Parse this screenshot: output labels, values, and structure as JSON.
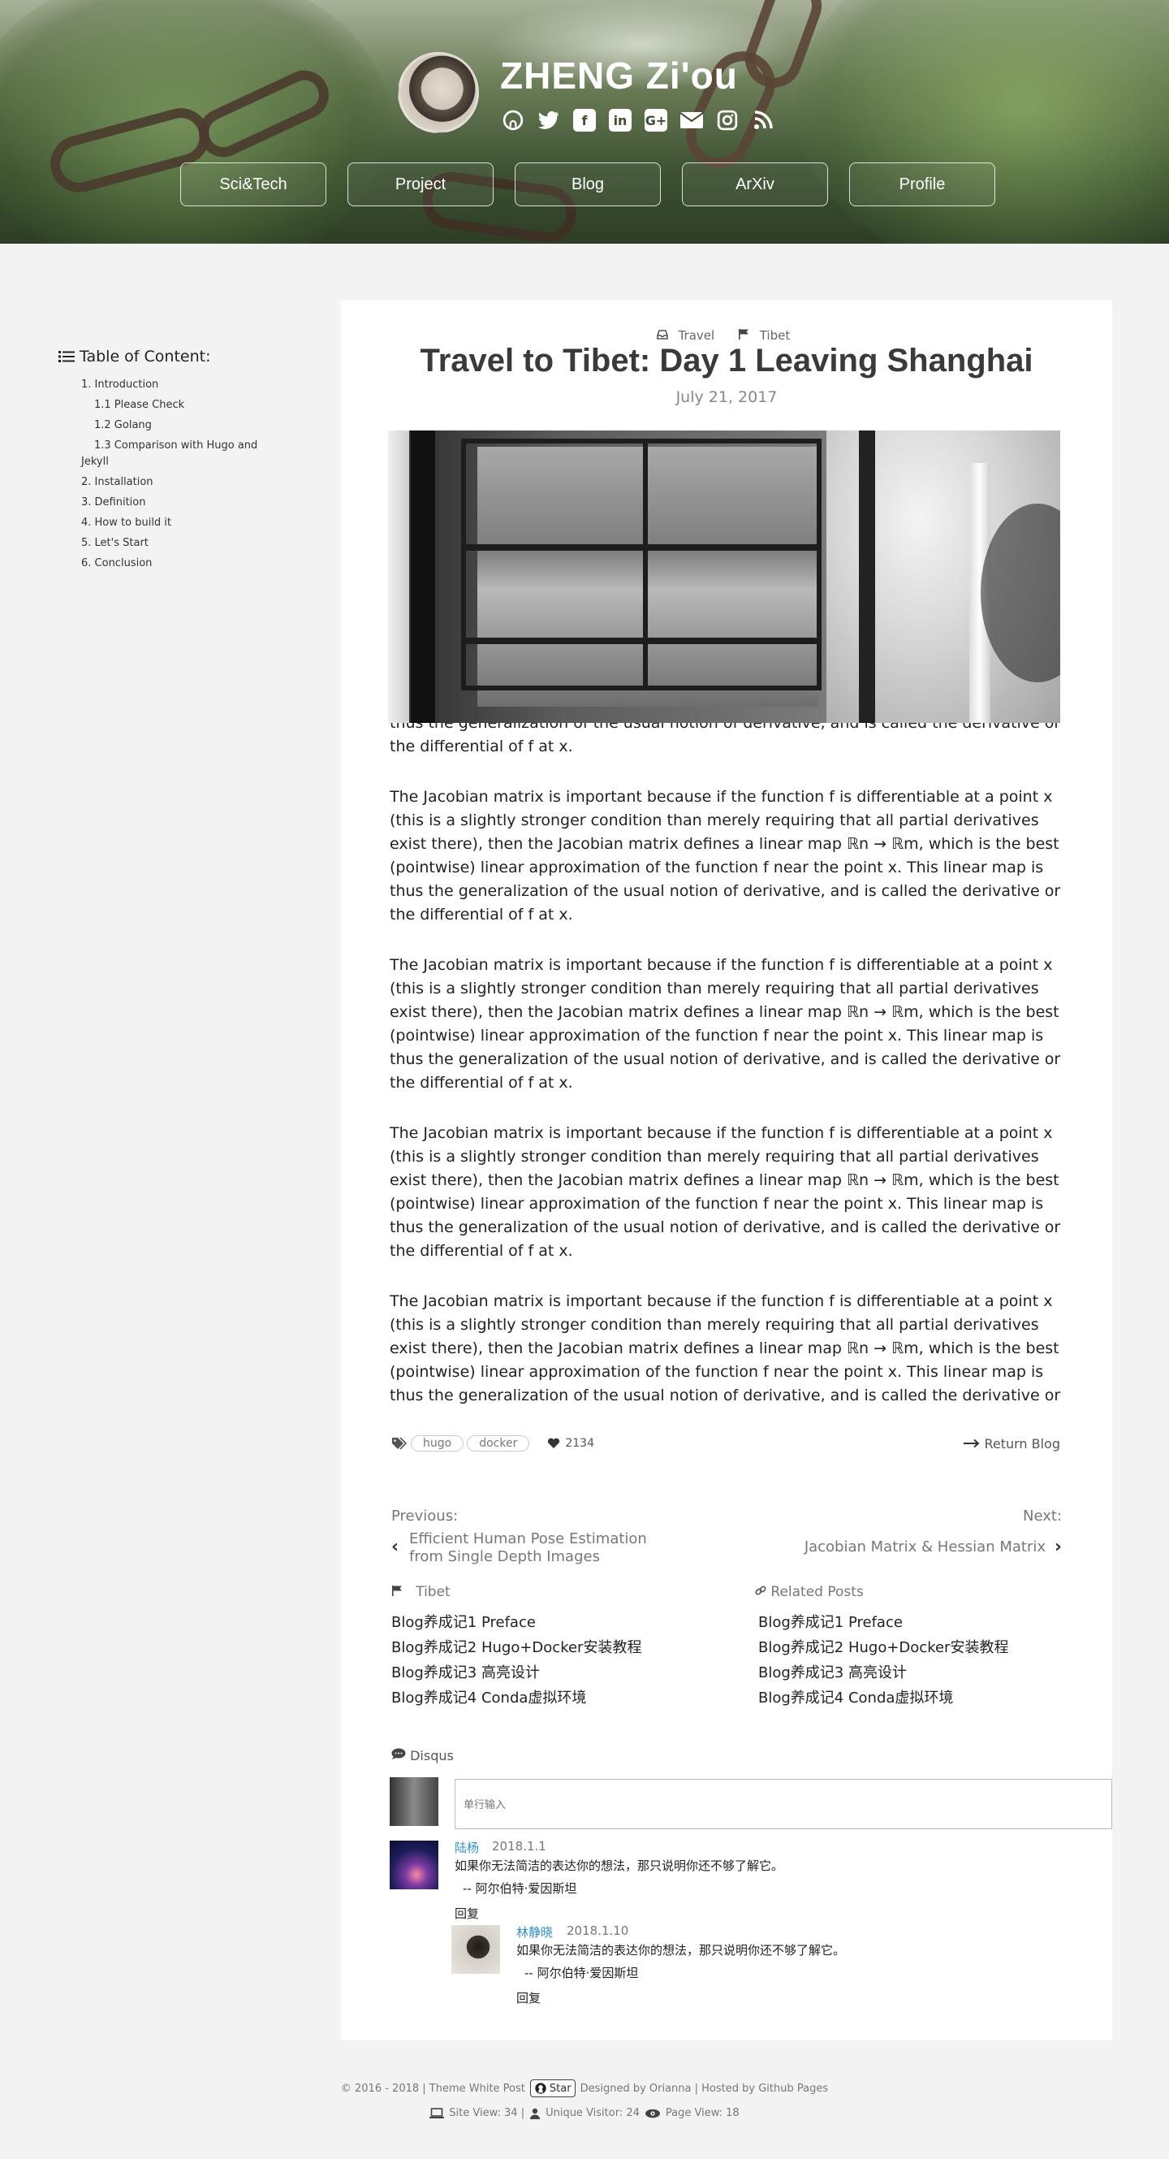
{
  "header": {
    "site_title": "ZHENG Zi'ou",
    "social_icons": [
      "github-icon",
      "twitter-icon",
      "facebook-icon",
      "linkedin-icon",
      "google-plus-icon",
      "email-icon",
      "instagram-icon",
      "rss-icon"
    ],
    "nav": [
      "Sci&Tech",
      "Project",
      "Blog",
      "ArXiv",
      "Profile"
    ]
  },
  "toc": {
    "title": "Table of Content:",
    "items": [
      {
        "label": "1. Introduction",
        "level": 1
      },
      {
        "label": "1.1 Please Check",
        "level": 2
      },
      {
        "label": "1.2 Golang",
        "level": 2
      },
      {
        "label": "1.3 Comparison with Hugo and Jekyll",
        "level": 2
      },
      {
        "label": "2. Installation",
        "level": 1
      },
      {
        "label": "3. Definition",
        "level": 1
      },
      {
        "label": "4. How to build it",
        "level": 1
      },
      {
        "label": "5. Let's Start",
        "level": 1
      },
      {
        "label": "6. Conclusion",
        "level": 1
      }
    ]
  },
  "post": {
    "category": "Travel",
    "series": "Tibet",
    "title": "Travel to Tibet: Day 1 Leaving Shanghai",
    "date": "July 21, 2017",
    "overflow_line": "thus the generalization of the usual notion of derivative, and is called the derivative or",
    "overflow_tail": "the differential of f at x.",
    "paragraph": "The Jacobian matrix is important because if the function f is differentiable at a point x (this is a slightly stronger condition than merely requiring that all partial derivatives exist there), then the Jacobian matrix defines a linear map ℝn → ℝm, which is the best (pointwise) linear approximation of the function f near the point x. This linear map is thus the generalization of the usual notion of derivative, and is called the derivative or the differential of f at x.",
    "tags": [
      "hugo",
      "docker"
    ],
    "likes": "2134",
    "return_label": "Return Blog"
  },
  "pager": {
    "prev_label": "Previous:",
    "prev_title": "Efficient Human Pose Estimation from Single Depth Images",
    "next_label": "Next:",
    "next_title": "Jacobian Matrix & Hessian Matrix"
  },
  "series_list": {
    "title": "Tibet",
    "items": [
      "Blog养成记1 Preface",
      "Blog养成记2 Hugo+Docker安装教程",
      "Blog养成记3 高亮设计",
      "Blog养成记4 Conda虚拟环境"
    ]
  },
  "related": {
    "title": "Related Posts",
    "items": [
      "Blog养成记1 Preface",
      "Blog养成记2 Hugo+Docker安装教程",
      "Blog养成记3 高亮设计",
      "Blog养成记4 Conda虚拟环境"
    ]
  },
  "comments": {
    "title": "Disqus",
    "placeholder": "单行输入",
    "list": [
      {
        "name": "陆杨",
        "date": "2018.1.1",
        "text": "如果你无法简洁的表达你的想法，那只说明你还不够了解它。",
        "quote": "-- 阿尔伯特·爱因斯坦",
        "reply": "回复"
      },
      {
        "name": "林静晓",
        "date": "2018.1.10",
        "text": "如果你无法简洁的表达你的想法，那只说明你还不够了解它。",
        "quote": "-- 阿尔伯特·爱因斯坦",
        "reply": "回复"
      }
    ]
  },
  "footer": {
    "copyright": "© 2016 - 2018 | Theme White Post",
    "star": "Star",
    "designed": "Designed by Orianna |  Hosted by Github Pages",
    "site_view": "Site View: 34 |",
    "visitor": "Unique Visitor: 24",
    "page_view": "Page View: 18"
  }
}
